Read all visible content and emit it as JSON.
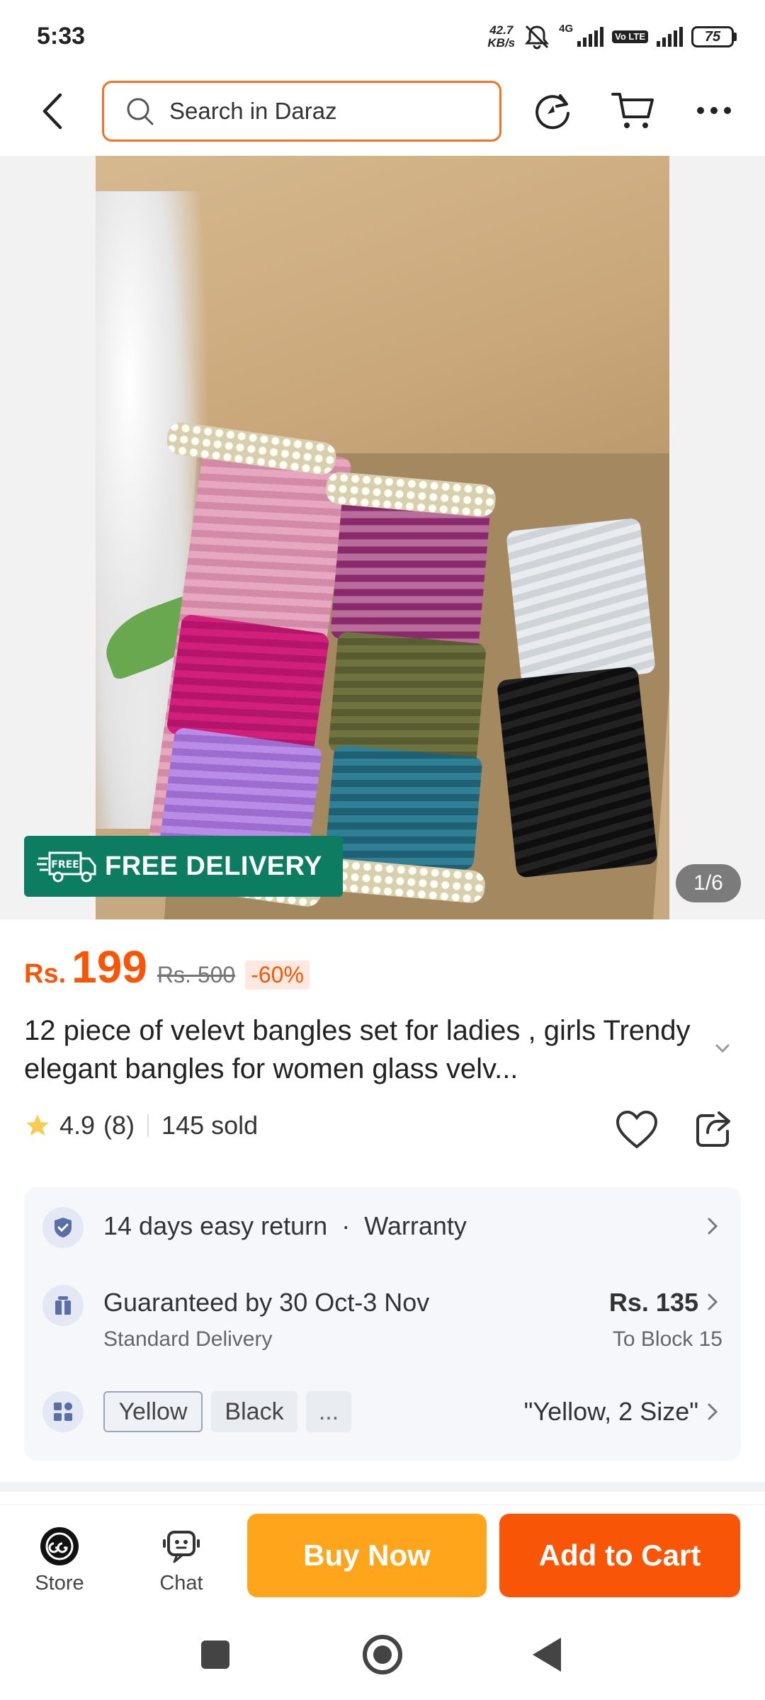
{
  "status_bar": {
    "time": "5:33",
    "speed_value": "42.7",
    "speed_unit": "KB/s",
    "network": "4G",
    "volte": "Vo LTE",
    "battery": "75"
  },
  "top_nav": {
    "search_placeholder": "Search in Daraz",
    "icons": [
      "back-arrow-icon",
      "search-icon",
      "refresh-icon",
      "cart-icon",
      "more-icon"
    ]
  },
  "gallery": {
    "badge_text": "FREE DELIVERY",
    "badge_truck_text": "FREE",
    "counter": "1/6"
  },
  "product": {
    "currency": "Rs.",
    "price": "199",
    "original_price": "Rs. 500",
    "discount": "-60%",
    "title": "12 piece of velevt bangles set for ladies , girls Trendy elegant bangles for women glass velv...",
    "rating": "4.9",
    "rating_count": "(8)",
    "sold": "145 sold"
  },
  "info_card": {
    "return_text": "14 days easy return",
    "warranty_text": "Warranty",
    "delivery_text": "Guaranteed by 30 Oct-3 Nov",
    "delivery_sub": "Standard Delivery",
    "delivery_price": "Rs. 135",
    "delivery_dest": "To Block 15",
    "variant_chips": [
      "Yellow",
      "Black",
      "..."
    ],
    "variant_selected": "\"Yellow, 2 Size\""
  },
  "bottom_bar": {
    "store_label": "Store",
    "chat_label": "Chat",
    "buy_now": "Buy Now",
    "add_to_cart": "Add to Cart"
  },
  "colors": {
    "accent": "#f85606",
    "buy_now": "#ffa51c",
    "free_badge": "#0d7d62"
  }
}
